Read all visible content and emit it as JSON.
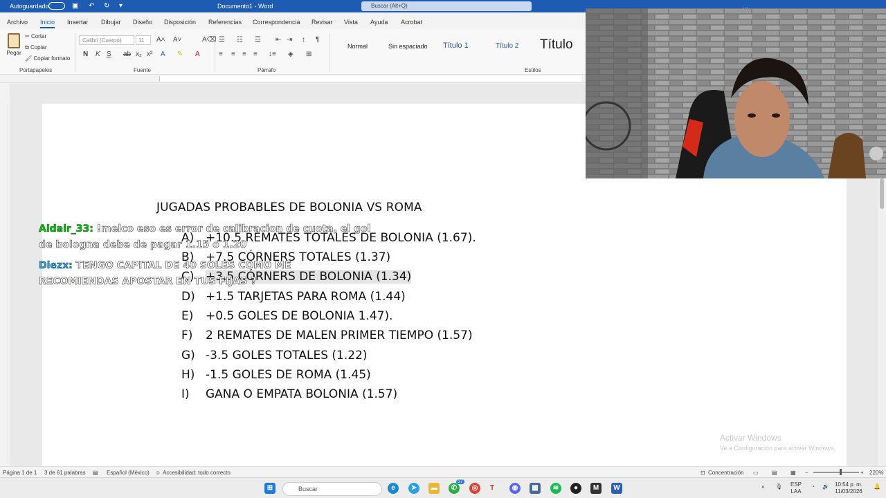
{
  "titlebar": {
    "autosave": "Autoguardado",
    "document_title": "Documento1 - Word",
    "search_placeholder": "Buscar (Alt+Q)",
    "user": "…"
  },
  "tabs": [
    "Archivo",
    "Inicio",
    "Insertar",
    "Dibujar",
    "Diseño",
    "Disposición",
    "Referencias",
    "Correspondencia",
    "Revisar",
    "Vista",
    "Ayuda",
    "Acrobat"
  ],
  "active_tab": "Inicio",
  "ribbon": {
    "clipboard": {
      "paste": "Pegar",
      "cut": "Cortar",
      "copy": "Copiar",
      "format_painter": "Copiar formato",
      "group_label": "Portapapeles"
    },
    "font": {
      "family": "Calibri (Cuerpo)",
      "size": "11",
      "group_label": "Fuente"
    },
    "paragraph": {
      "group_label": "Párrafo"
    },
    "styles": {
      "items": [
        "Normal",
        "Sin espaciado",
        "Título 1",
        "Título 2",
        "Título"
      ],
      "group_label": "Estilos"
    }
  },
  "document": {
    "heading": "JUGADAS PROBABLES DE BOLONIA VS ROMA",
    "items": [
      {
        "letter": "A)",
        "text": "+10.5 REMATES TOTALES DE BOLONIA (1.67)."
      },
      {
        "letter": "B)",
        "text": "+7.5 CÓRNERS TOTALES (1.37)"
      },
      {
        "letter": "C)",
        "text": "+3.5 CÓRNERS DE BOLONIA (1.34)"
      },
      {
        "letter": "D)",
        "text": "+1.5 TARJETAS PARA ROMA (1.44)"
      },
      {
        "letter": "E)",
        "text": "+0.5 GOLES DE BOLONIA 1.47)."
      },
      {
        "letter": "F)",
        "text": "2 REMATES DE MALEN PRIMER TIEMPO (1.57)"
      },
      {
        "letter": "G)",
        "text": "-3.5 GOLES TOTALES (1.22)"
      },
      {
        "letter": "H)",
        "text": "-1.5 GOLES DE ROMA (1.45)"
      },
      {
        "letter": "I)",
        "text": "GANA O EMPATA BOLONIA (1.57)"
      }
    ]
  },
  "chat": [
    {
      "user": "Aldair_33:",
      "line1": " !melco eso es error de calibracion de cuota, el gol",
      "line2": "de bologna debe de pagar 1.15 o 1.20"
    },
    {
      "user": "Diezx:",
      "line1": " TENGO CAPITAL DE 40 SOLES COMO ME",
      "line2": "RECOMIENDAS APOSTAR EN TUS FIJAS ?"
    }
  ],
  "watermark": {
    "title": "Activar Windows",
    "subtitle": "Ve a Configuración para activar Windows."
  },
  "statusbar": {
    "page": "Página 1 de 1",
    "words": "3 de 61 palabras",
    "language": "Español (México)",
    "accessibility": "Accesibilidad: todo correcto",
    "focus": "Concentración",
    "zoom": "220%"
  },
  "taskbar": {
    "search_placeholder": "Buscar",
    "badge": "57",
    "lang": "ESP",
    "lang_sub": "LAA",
    "time": "10:54 p. m.",
    "date": "11/03/2026"
  },
  "colors": {
    "titlebar": "#1e5cb3",
    "chat_user1": "#19c419",
    "chat_user2": "#3aa0d8"
  }
}
